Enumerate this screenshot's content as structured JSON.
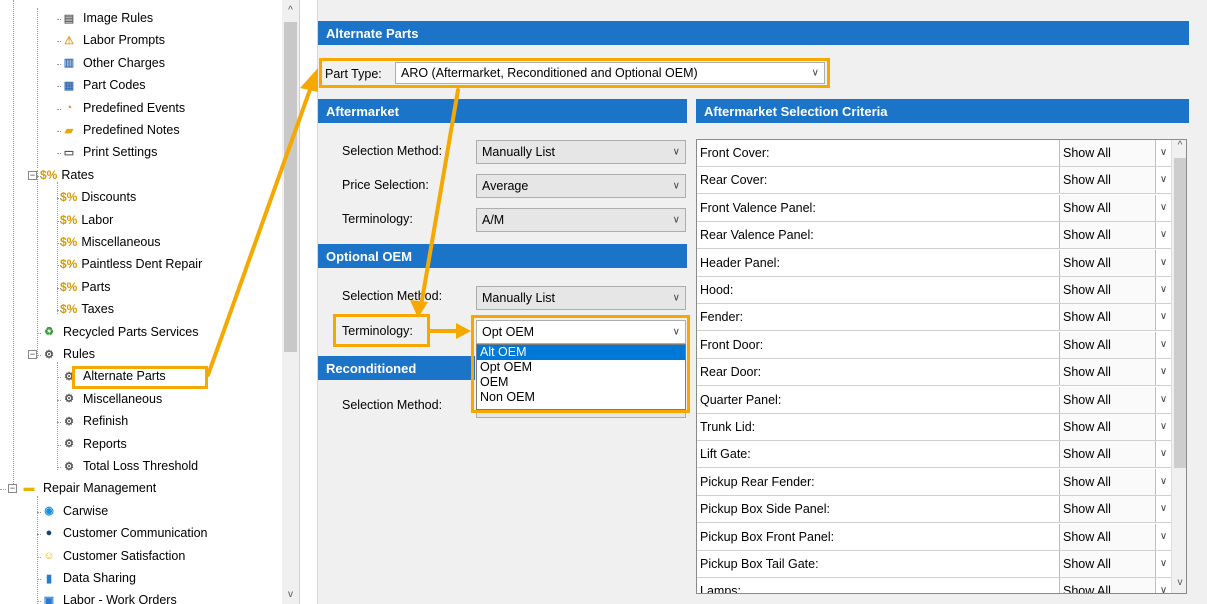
{
  "tree": {
    "items": [
      {
        "label": "Image Rules",
        "icon": "document-icon",
        "level": 2
      },
      {
        "label": "Labor Prompts",
        "icon": "labor-icon",
        "level": 2
      },
      {
        "label": "Other Charges",
        "icon": "charges-icon",
        "level": 2
      },
      {
        "label": "Part Codes",
        "icon": "part-codes-icon",
        "level": 2
      },
      {
        "label": "Predefined Events",
        "icon": "events-icon",
        "level": 2
      },
      {
        "label": "Predefined Notes",
        "icon": "notes-icon",
        "level": 2
      },
      {
        "label": "Print Settings",
        "icon": "printer-icon",
        "level": 2
      },
      {
        "label": "Rates",
        "icon": "rates-icon",
        "level": 1,
        "expander": "−"
      },
      {
        "label": "Discounts",
        "icon": "rates-icon",
        "level": 2
      },
      {
        "label": "Labor",
        "icon": "rates-icon",
        "level": 2
      },
      {
        "label": "Miscellaneous",
        "icon": "rates-icon",
        "level": 2
      },
      {
        "label": "Paintless Dent Repair",
        "icon": "rates-icon",
        "level": 2
      },
      {
        "label": "Parts",
        "icon": "rates-icon",
        "level": 2
      },
      {
        "label": "Taxes",
        "icon": "rates-icon",
        "level": 2
      },
      {
        "label": "Recycled Parts Services",
        "icon": "recycle-icon",
        "level": 1
      },
      {
        "label": "Rules",
        "icon": "rules-icon",
        "level": 1,
        "expander": "−"
      },
      {
        "label": "Alternate Parts",
        "icon": "rules-icon",
        "level": 2,
        "selected": true
      },
      {
        "label": "Miscellaneous",
        "icon": "rules-icon",
        "level": 2
      },
      {
        "label": "Refinish",
        "icon": "rules-icon",
        "level": 2
      },
      {
        "label": "Reports",
        "icon": "rules-icon",
        "level": 2
      },
      {
        "label": "Total Loss Threshold",
        "icon": "rules-icon",
        "level": 2
      },
      {
        "label": "Repair Management",
        "icon": "folder-icon",
        "level": 0,
        "expander": "−"
      },
      {
        "label": "Carwise",
        "icon": "carwise-icon",
        "level": 1
      },
      {
        "label": "Customer Communication",
        "icon": "chat-icon",
        "level": 1
      },
      {
        "label": "Customer Satisfaction",
        "icon": "smiley-icon",
        "level": 1
      },
      {
        "label": "Data Sharing",
        "icon": "data-sharing-icon",
        "level": 1
      },
      {
        "label": "Labor - Work Orders",
        "icon": "work-orders-icon",
        "level": 1
      }
    ],
    "rates_symbol": "$%"
  },
  "main": {
    "title": "Alternate Parts",
    "part_type_label": "Part Type:",
    "part_type_value": "ARO (Aftermarket, Reconditioned and Optional OEM)",
    "aftermarket": {
      "title": "Aftermarket",
      "selection_method_label": "Selection Method:",
      "selection_method_value": "Manually List",
      "price_selection_label": "Price Selection:",
      "price_selection_value": "Average",
      "terminology_label": "Terminology:",
      "terminology_value": "A/M"
    },
    "optional_oem": {
      "title": "Optional OEM",
      "selection_method_label": "Selection Method:",
      "selection_method_value": "Manually List",
      "terminology_label": "Terminology:",
      "terminology_value": "Opt OEM",
      "options": [
        "Alt OEM",
        "Opt OEM",
        "OEM",
        "Non OEM"
      ],
      "highlighted_option": "Alt OEM"
    },
    "reconditioned": {
      "title": "Reconditioned",
      "selection_method_label": "Selection Method:"
    },
    "criteria": {
      "title": "Aftermarket Selection Criteria",
      "rows": [
        {
          "name": "Front Cover:",
          "value": "Show All"
        },
        {
          "name": "Rear Cover:",
          "value": "Show All"
        },
        {
          "name": "Front Valence Panel:",
          "value": "Show All"
        },
        {
          "name": "Rear Valence Panel:",
          "value": "Show All"
        },
        {
          "name": "Header Panel:",
          "value": "Show All"
        },
        {
          "name": "Hood:",
          "value": "Show All"
        },
        {
          "name": "Fender:",
          "value": "Show All"
        },
        {
          "name": "Front Door:",
          "value": "Show All"
        },
        {
          "name": "Rear Door:",
          "value": "Show All"
        },
        {
          "name": "Quarter Panel:",
          "value": "Show All"
        },
        {
          "name": "Trunk Lid:",
          "value": "Show All"
        },
        {
          "name": "Lift Gate:",
          "value": "Show All"
        },
        {
          "name": "Pickup Rear Fender:",
          "value": "Show All"
        },
        {
          "name": "Pickup Box Side Panel:",
          "value": "Show All"
        },
        {
          "name": "Pickup Box Front Panel:",
          "value": "Show All"
        },
        {
          "name": "Pickup Box Tail Gate:",
          "value": "Show All"
        },
        {
          "name": "Lamps:",
          "value": "Show All"
        }
      ]
    }
  },
  "colors": {
    "header_blue": "#1c74c9",
    "highlight_orange": "#f5a800",
    "selection_blue": "#0078d7"
  }
}
